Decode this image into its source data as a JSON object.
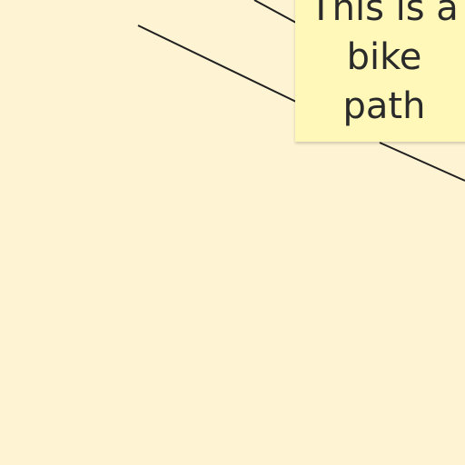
{
  "canvas": {
    "background_color": "#fef3d3"
  },
  "sticky_note": {
    "text": "This is a\nbike\npath",
    "color": "#fff8b8",
    "text_color": "#2a2a2a"
  },
  "connectors": {
    "stroke_color": "#1f1f1f"
  }
}
